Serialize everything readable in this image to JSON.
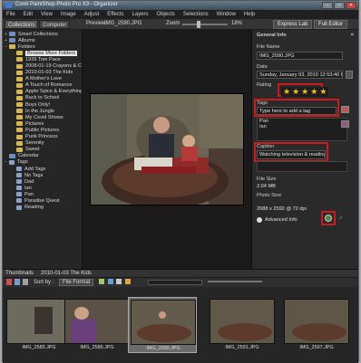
{
  "window": {
    "title": "Corel PaintShop Photo Pro X3 - Organizer",
    "min": "–",
    "max": "□",
    "close": "✕"
  },
  "menu": [
    "File",
    "Edit",
    "View",
    "Image",
    "Adjust",
    "Effects",
    "Layers",
    "Objects",
    "Selections",
    "Window",
    "Help"
  ],
  "toolbar": {
    "tab_collections": "Collections",
    "tab_computer": "Computer",
    "preview_label": "Preview",
    "filename": "IMG_2590.JPG",
    "zoom_label": "Zoom",
    "zoom_value": "18%",
    "express_lab": "Express Lab",
    "full_editor": "Full Editor"
  },
  "tree": [
    {
      "label": "Smart Collections",
      "indent": 0,
      "type": "blue",
      "exp": "+"
    },
    {
      "label": "Albums",
      "indent": 0,
      "type": "blue",
      "exp": "+"
    },
    {
      "label": "Folders",
      "indent": 0,
      "type": "folder",
      "exp": "−"
    },
    {
      "label": "Browse More Folders",
      "indent": 1,
      "type": "folder",
      "exp": "",
      "selected": true
    },
    {
      "label": "1939 Tom Pace",
      "indent": 1,
      "type": "folder",
      "exp": ""
    },
    {
      "label": "2008-01-19 Crayons & Co.",
      "indent": 1,
      "type": "folder",
      "exp": ""
    },
    {
      "label": "2010-01-03 The Kids",
      "indent": 1,
      "type": "folder",
      "exp": ""
    },
    {
      "label": "A Mother's Love",
      "indent": 1,
      "type": "folder",
      "exp": ""
    },
    {
      "label": "A Touch of Romance",
      "indent": 1,
      "type": "folder",
      "exp": ""
    },
    {
      "label": "Apple Spice & Everything N",
      "indent": 1,
      "type": "folder",
      "exp": ""
    },
    {
      "label": "Back to School",
      "indent": 1,
      "type": "folder",
      "exp": ""
    },
    {
      "label": "Boys Only!",
      "indent": 1,
      "type": "folder",
      "exp": ""
    },
    {
      "label": "In the Jungle",
      "indent": 1,
      "type": "folder",
      "exp": ""
    },
    {
      "label": "My Covid Shows",
      "indent": 1,
      "type": "folder",
      "exp": ""
    },
    {
      "label": "Pictures",
      "indent": 1,
      "type": "folder",
      "exp": ""
    },
    {
      "label": "Public Pictures",
      "indent": 1,
      "type": "folder",
      "exp": ""
    },
    {
      "label": "Punk Princess",
      "indent": 1,
      "type": "folder",
      "exp": ""
    },
    {
      "label": "Serenity",
      "indent": 1,
      "type": "folder",
      "exp": ""
    },
    {
      "label": "Sweet",
      "indent": 1,
      "type": "folder",
      "exp": ""
    },
    {
      "label": "Calendar",
      "indent": 0,
      "type": "blue",
      "exp": ""
    },
    {
      "label": "Tags",
      "indent": 0,
      "type": "tag",
      "exp": "−"
    },
    {
      "label": "Add Tags",
      "indent": 1,
      "type": "tag",
      "exp": ""
    },
    {
      "label": "No Tags",
      "indent": 1,
      "type": "tag",
      "exp": ""
    },
    {
      "label": "Dad",
      "indent": 1,
      "type": "tag",
      "exp": ""
    },
    {
      "label": "Ian",
      "indent": 1,
      "type": "tag",
      "exp": ""
    },
    {
      "label": "Pan",
      "indent": 1,
      "type": "tag",
      "exp": ""
    },
    {
      "label": "Paradise Quest",
      "indent": 1,
      "type": "tag",
      "exp": ""
    },
    {
      "label": "Reading",
      "indent": 1,
      "type": "tag",
      "exp": ""
    }
  ],
  "info": {
    "header": "General Info",
    "file_name_label": "File Name",
    "file_name": "IMG_2590.JPG",
    "date_label": "Date",
    "date": "Sunday, January 03, 2010 12:53:40 PM",
    "rating_label": "Rating",
    "rating": 5,
    "rating_max": 5,
    "tags_label": "Tags",
    "tags_placeholder": "Type here to add a tag",
    "tag_items": [
      "Pan",
      "Ian"
    ],
    "caption_label": "Caption",
    "caption": "Watching television & reading",
    "file_size_label": "File Size",
    "file_size": "2.04 MB",
    "photo_size_label": "Photo Size",
    "photo_size": "2688 x 2592 @ 72 dpi",
    "advanced_info": "Advanced Info"
  },
  "bottom": {
    "tab": "Thumbnails",
    "path": "2010-01-03 The Kids",
    "sort_by": "Sort by :",
    "sort_value": "File Format",
    "thumbs": [
      {
        "name": "IMG_2585.JPG",
        "num": "1"
      },
      {
        "name": "IMG_2586.JPG",
        "num": "3"
      },
      {
        "name": "IMG_2590.JPG",
        "num": "3",
        "selected": true
      },
      {
        "name": "IMG_2591.JPG",
        "num": "2"
      },
      {
        "name": "IMG_2597.JPG",
        "num": "1"
      }
    ]
  },
  "colors": {
    "accent_red": "#d0191c",
    "star": "#f4c20d"
  }
}
